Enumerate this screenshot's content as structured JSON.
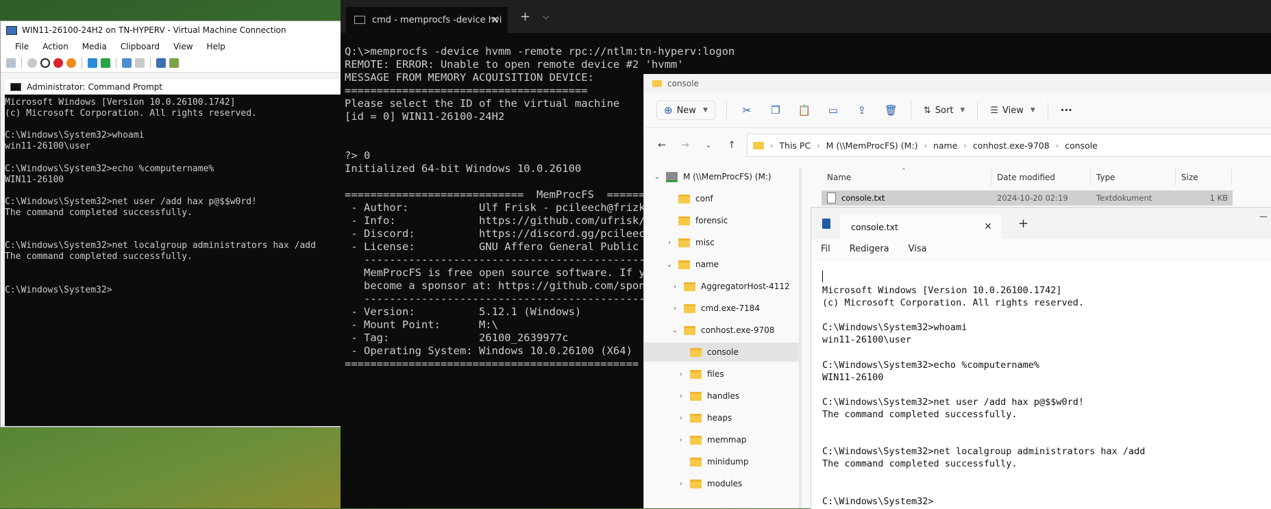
{
  "vm_window": {
    "title": "WIN11-26100-24H2 on TN-HYPERV - Virtual Machine Connection",
    "menu": [
      "File",
      "Action",
      "Media",
      "Clipboard",
      "View",
      "Help"
    ]
  },
  "inner_cmd": {
    "title": "Administrator: Command Prompt",
    "lines": [
      "Microsoft Windows [Version 10.0.26100.1742]",
      "(c) Microsoft Corporation. All rights reserved.",
      "",
      "C:\\Windows\\System32>whoami",
      "win11-26100\\user",
      "",
      "C:\\Windows\\System32>echo %computername%",
      "WIN11-26100",
      "",
      "C:\\Windows\\System32>net user /add hax p@$$w0rd!",
      "The command completed successfully.",
      "",
      "",
      "C:\\Windows\\System32>net localgroup administrators hax /add",
      "The command completed successfully.",
      "",
      "",
      "C:\\Windows\\System32>"
    ]
  },
  "terminal": {
    "tab_title": "cmd - memprocfs  -device hvi",
    "lines": [
      "Q:\\>memprocfs -device hvmm -remote rpc://ntlm:tn-hyperv:logon",
      "REMOTE: ERROR: Unable to open remote device #2 'hvmm'",
      "MESSAGE FROM MEMORY ACQUISITION DEVICE:",
      "======================================",
      "Please select the ID of the virtual machine",
      "[id = 0] WIN11-26100-24H2",
      "",
      "",
      "?> 0",
      "Initialized 64-bit Windows 10.0.26100",
      "",
      "============================  MemProcFS  ======",
      " - Author:           Ulf Frisk - pcileech@frizk.n",
      " - Info:             https://github.com/ufrisk/Me",
      " - Discord:          https://discord.gg/pcileech",
      " - License:          GNU Affero General Public Li",
      "   ---------------------------------------------",
      "   MemProcFS is free open source software. If you",
      "   become a sponsor at: https://github.com/sponso",
      "   ---------------------------------------------",
      " - Version:          5.12.1 (Windows)",
      " - Mount Point:      M:\\",
      " - Tag:              26100_2639977c",
      " - Operating System: Windows 10.0.26100 (X64)",
      "=============================================="
    ]
  },
  "explorer": {
    "title": "console",
    "toolbar": {
      "new": "New",
      "sort": "Sort",
      "view": "View",
      "more": "···"
    },
    "breadcrumb": [
      "This PC",
      "M (\\\\MemProcFS) (M:)",
      "name",
      "conhost.exe-9708",
      "console"
    ],
    "nav_items": [
      {
        "label": "M (\\\\MemProcFS) (M:)"
      },
      {
        "label": "conf"
      },
      {
        "label": "forensic"
      },
      {
        "label": "misc"
      },
      {
        "label": "name"
      },
      {
        "label": "AggregatorHost-4112"
      },
      {
        "label": "cmd.exe-7184"
      },
      {
        "label": "conhost.exe-9708"
      },
      {
        "label": "console"
      },
      {
        "label": "files"
      },
      {
        "label": "handles"
      },
      {
        "label": "heaps"
      },
      {
        "label": "memmap"
      },
      {
        "label": "minidump"
      },
      {
        "label": "modules"
      }
    ],
    "columns": [
      "Name",
      "Date modified",
      "Type",
      "Size"
    ],
    "file": {
      "name": "console.txt",
      "date": "2024-10-20 02:19",
      "type": "Textdokument",
      "size": "1 KB"
    }
  },
  "notepad": {
    "tab_title": "console.txt",
    "menu": [
      "Fil",
      "Redigera",
      "Visa"
    ],
    "lines": [
      "Microsoft Windows [Version 10.0.26100.1742]",
      "(c) Microsoft Corporation. All rights reserved.",
      "",
      "C:\\Windows\\System32>whoami",
      "win11-26100\\user",
      "",
      "C:\\Windows\\System32>echo %computername%",
      "WIN11-26100",
      "",
      "C:\\Windows\\System32>net user /add hax p@$$w0rd!",
      "The command completed successfully.",
      "",
      "",
      "C:\\Windows\\System32>net localgroup administrators hax /add",
      "The command completed successfully.",
      "",
      "",
      "C:\\Windows\\System32>"
    ]
  },
  "colors": {
    "terminal_bg": "#0c0c0c",
    "terminal_fg": "#cccccc",
    "folder": "#f7c948",
    "accent": "#1e5aa8"
  }
}
